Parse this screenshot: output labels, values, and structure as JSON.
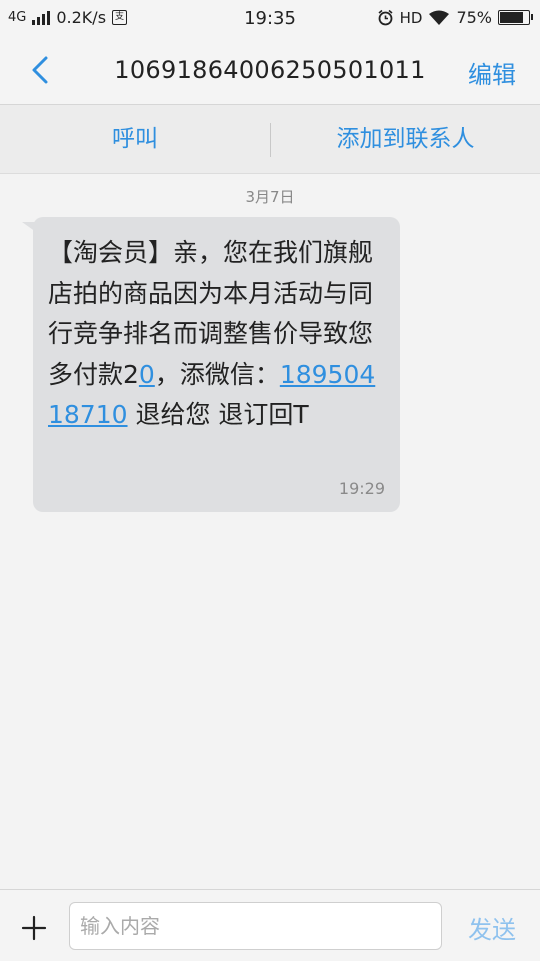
{
  "status_bar": {
    "network": "4G",
    "speed": "0.2K/s",
    "notify_glyph": "支",
    "time": "19:35",
    "hd": "HD",
    "battery": "75%",
    "battery_level": 0.75
  },
  "header": {
    "back_icon": "chevron-left-icon",
    "title": "10691864006250501011",
    "edit_label": "编辑"
  },
  "actions": {
    "call_label": "呼叫",
    "add_contact_label": "添加到联系人"
  },
  "conversation": {
    "date": "3月7日",
    "message": {
      "text_before": "【淘会员】亲，您在我们旗舰店拍的商品因为本月活动与同行竞争排名而调整售价导致您多付款2",
      "link_inline": "0",
      "text_middle": "，添微信：",
      "phone_link": "18950418710",
      "text_after": " 退给您 退订回T",
      "time": "19:29"
    }
  },
  "input_bar": {
    "plus_icon": "plus-icon",
    "placeholder": "输入内容",
    "value": "",
    "send_label": "发送"
  },
  "colors": {
    "accent": "#2f8fdf",
    "bubble": "#dedfe1",
    "background": "#f3f3f3",
    "send_disabled": "#8fc2ee"
  }
}
